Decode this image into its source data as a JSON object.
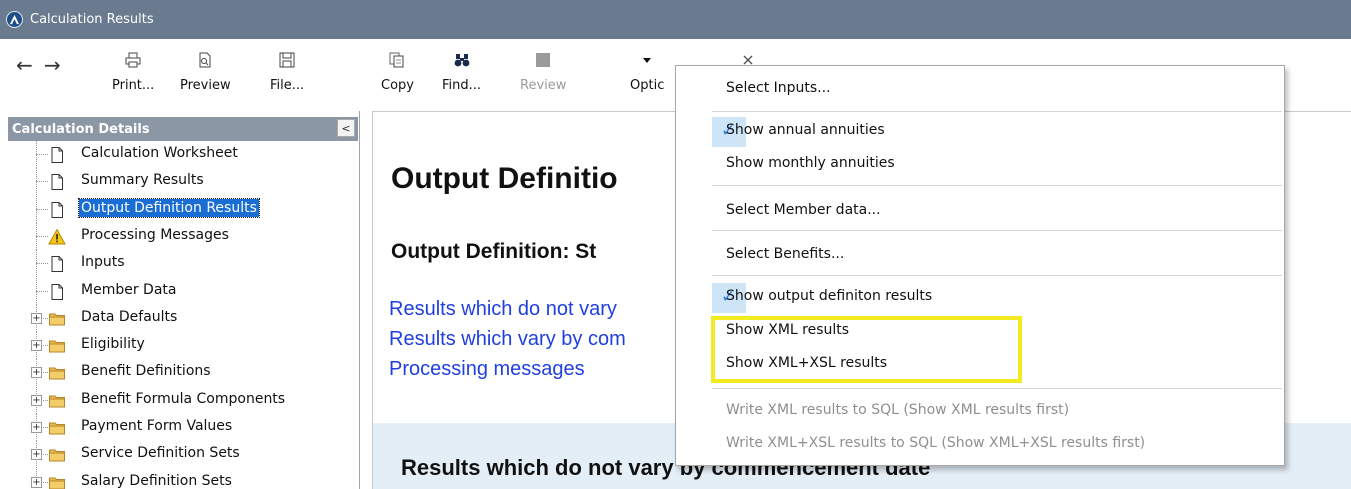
{
  "window": {
    "title": "Calculation Results"
  },
  "toolbar": {
    "back_glyph": "←",
    "forward_glyph": "→",
    "buttons": [
      {
        "label": "Print...",
        "icon": "print-icon"
      },
      {
        "label": "Preview",
        "icon": "preview-icon"
      },
      {
        "label": "File...",
        "icon": "save-file-icon"
      },
      {
        "label": "Copy",
        "icon": "copy-icon"
      },
      {
        "label": "Find...",
        "icon": "find-binoculars-icon"
      },
      {
        "label": "Review",
        "icon": "review-icon",
        "disabled": true
      },
      {
        "label": "Optic",
        "icon": "options-dropdown-icon"
      },
      {
        "label": "",
        "icon": "close-x-icon"
      }
    ]
  },
  "left_panel": {
    "title": "Calculation Details",
    "collapse_glyph": "<",
    "tree": [
      {
        "label": "Calculation Worksheet",
        "icon": "document-icon",
        "selected": false
      },
      {
        "label": "Summary Results",
        "icon": "document-icon",
        "selected": false
      },
      {
        "label": "Output Definition Results",
        "icon": "document-icon",
        "selected": true
      },
      {
        "label": "Processing Messages",
        "icon": "warning-icon",
        "selected": false
      },
      {
        "label": "Inputs",
        "icon": "document-icon",
        "selected": false
      },
      {
        "label": "Member Data",
        "icon": "document-icon",
        "selected": false
      },
      {
        "label": "Data Defaults",
        "icon": "folder-icon",
        "expandable": true
      },
      {
        "label": "Eligibility",
        "icon": "folder-icon",
        "expandable": true
      },
      {
        "label": "Benefit Definitions",
        "icon": "folder-icon",
        "expandable": true
      },
      {
        "label": "Benefit Formula Components",
        "icon": "folder-icon",
        "expandable": true
      },
      {
        "label": "Payment Form Values",
        "icon": "folder-icon",
        "expandable": true
      },
      {
        "label": "Service Definition Sets",
        "icon": "folder-icon",
        "expandable": true
      },
      {
        "label": "Salary Definition Sets",
        "icon": "folder-icon",
        "expandable": true
      }
    ]
  },
  "content": {
    "title": "Output Definitio",
    "subtitle": "Output Definition: St",
    "links": [
      "Results which do not vary",
      "Results which vary by com",
      "Processing messages"
    ],
    "section_heading": "Results which do not vary by commencement date"
  },
  "menu": {
    "items": [
      {
        "label": "Select Inputs...",
        "checked": false,
        "disabled": false
      },
      {
        "label": "Show annual annuities",
        "checked": true,
        "disabled": false
      },
      {
        "label": "Show monthly annuities",
        "checked": false,
        "disabled": false
      },
      {
        "label": "Select Member data...",
        "checked": false,
        "disabled": false
      },
      {
        "label": "Select Benefits...",
        "checked": false,
        "disabled": false
      },
      {
        "label": "Show output definiton results",
        "checked": true,
        "disabled": false
      },
      {
        "label": "Show XML results",
        "checked": false,
        "disabled": false
      },
      {
        "label": "Show XML+XSL results",
        "checked": false,
        "disabled": false
      },
      {
        "label": "Write XML results to SQL (Show XML results first)",
        "checked": false,
        "disabled": true
      },
      {
        "label": "Write XML+XSL results to SQL (Show XML+XSL results first)",
        "checked": false,
        "disabled": true
      }
    ],
    "check_glyph": "✓"
  },
  "colors": {
    "titlebar": "#6b7b8f",
    "selection": "#1a6ed3",
    "link": "#1f3fe0",
    "highlight": "#f2eb20"
  }
}
